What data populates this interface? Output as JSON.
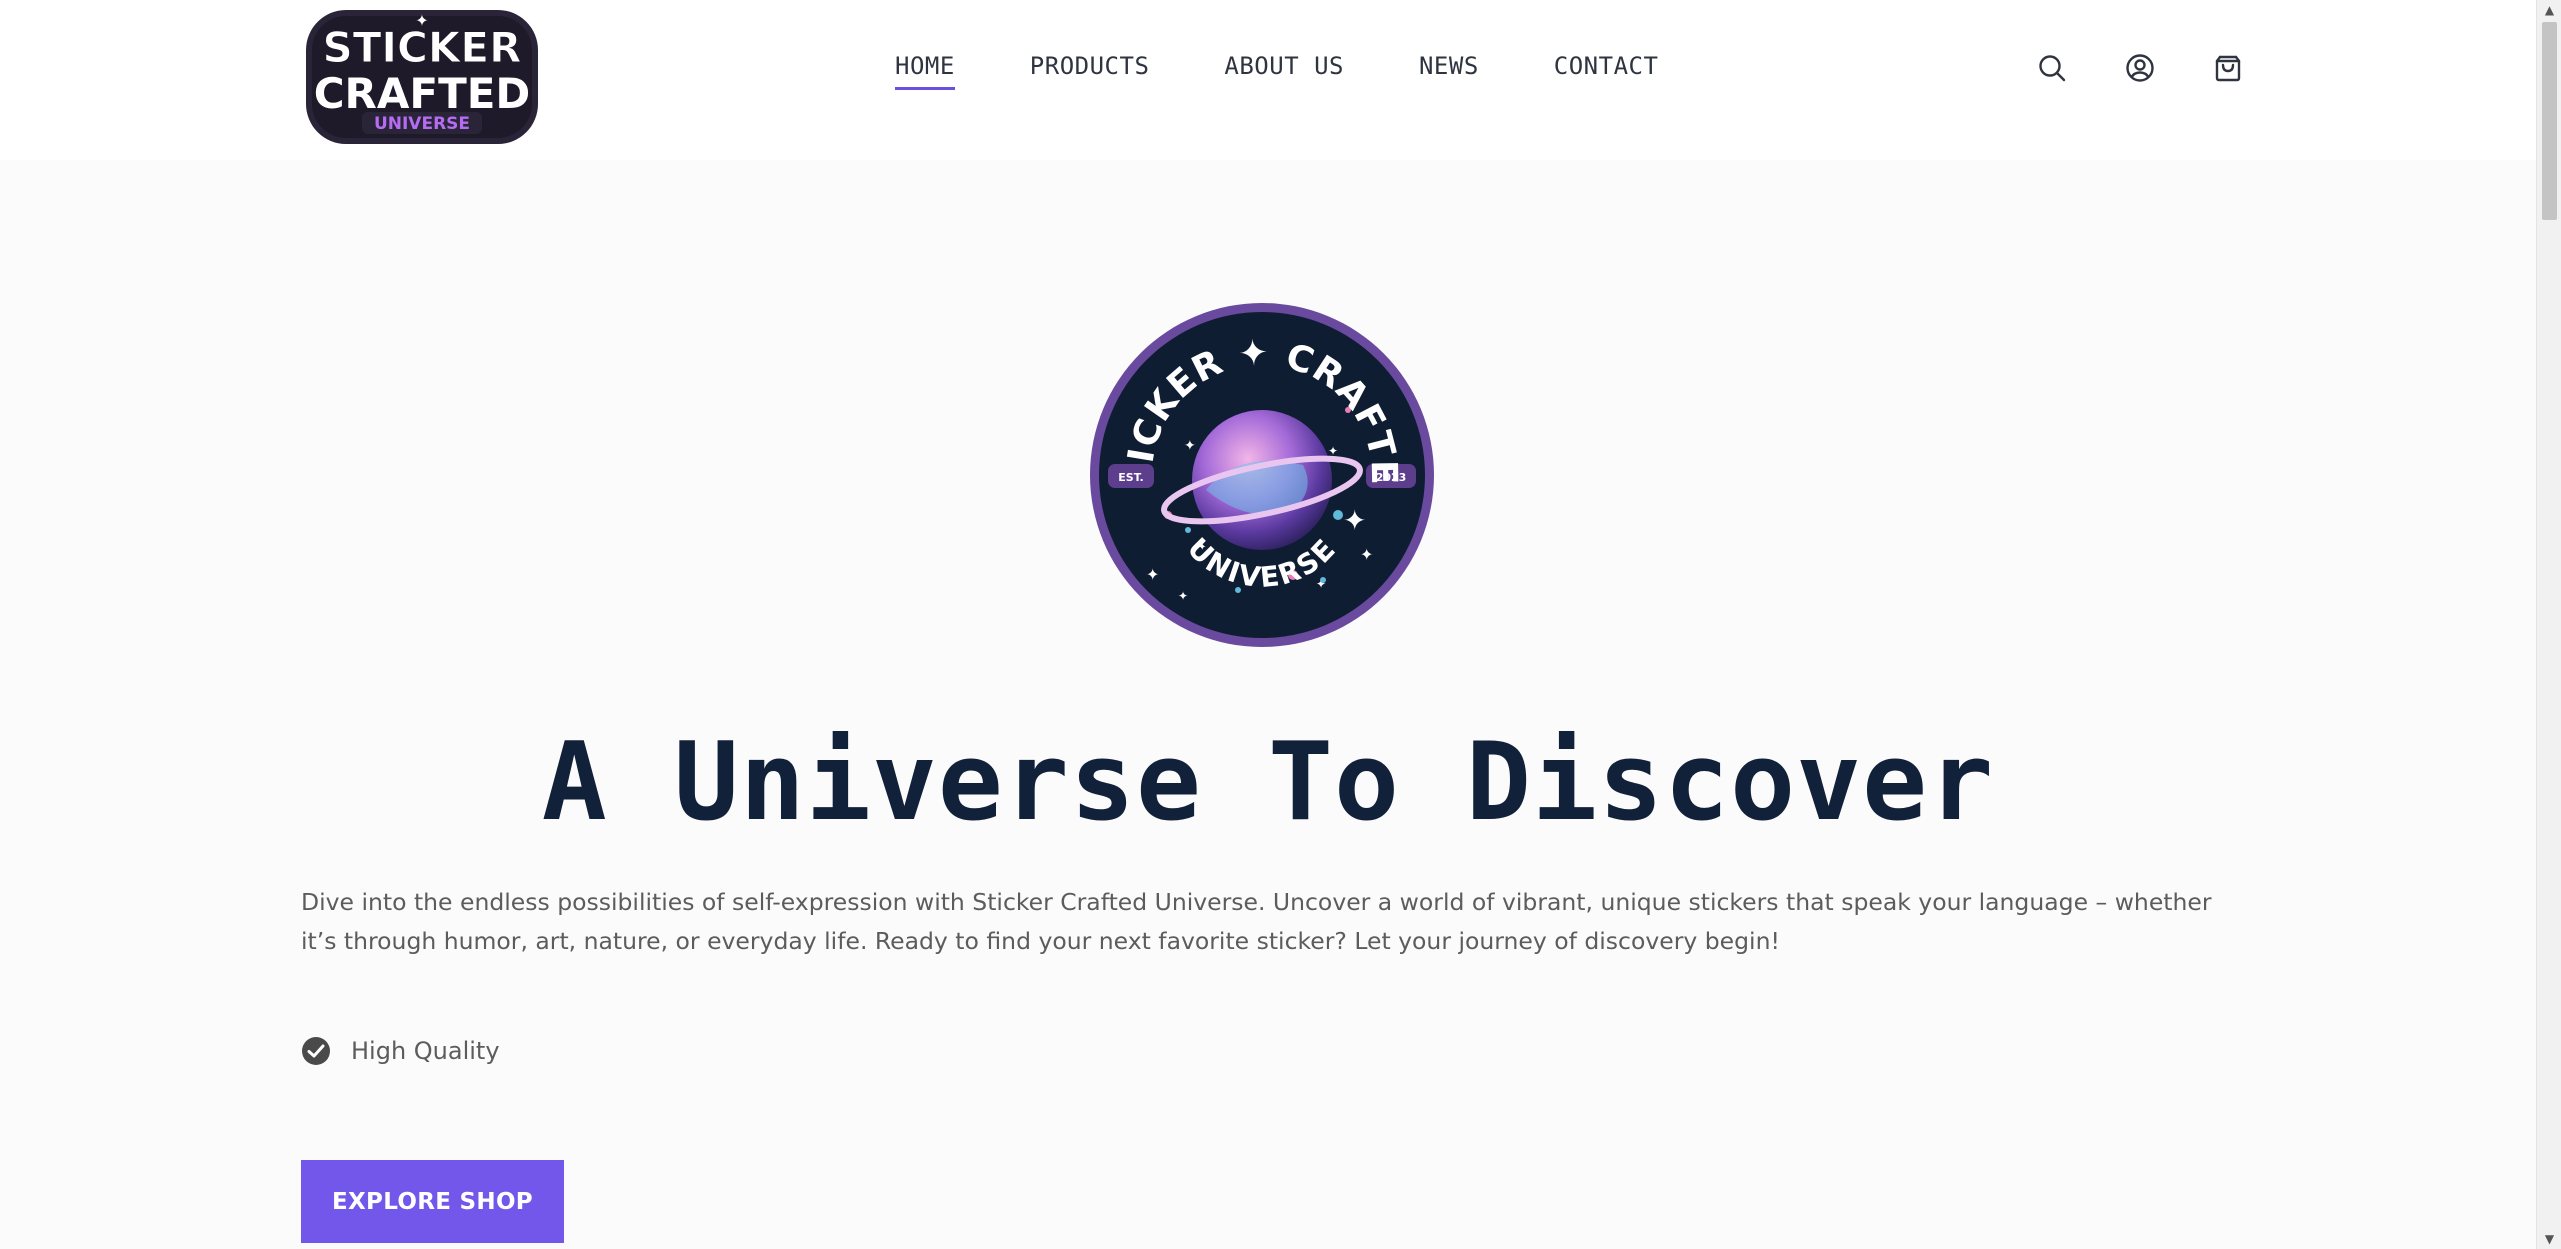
{
  "brand": {
    "logo_text_line1": "STICKER",
    "logo_text_line2": "CRAFTED",
    "logo_text_line3": "UNIVERSE",
    "accent_color": "#7356ea"
  },
  "nav": {
    "items": [
      {
        "label": "HOME",
        "active": true
      },
      {
        "label": "PRODUCTS",
        "active": false
      },
      {
        "label": "ABOUT US",
        "active": false
      },
      {
        "label": "NEWS",
        "active": false
      },
      {
        "label": "CONTACT",
        "active": false
      }
    ]
  },
  "header_icons": [
    "search-icon",
    "account-icon",
    "cart-icon"
  ],
  "hero": {
    "badge": {
      "top_text": "STICKER ✦ CRAFTED",
      "bottom_text": "UNIVERSE",
      "left_tag": "EST.",
      "right_tag": "2023"
    },
    "title": "A Universe To Discover",
    "description": "Dive into the endless possibilities of self-expression with Sticker Crafted Universe. Uncover a world of vibrant, unique stickers that speak your language – whether it’s through humor, art, nature, or everyday life. Ready to find your next favorite sticker? Let your journey of discovery begin!",
    "features": [
      {
        "icon": "check-circle-icon",
        "label": "High Quality"
      }
    ],
    "cta_label": "EXPLORE SHOP"
  }
}
